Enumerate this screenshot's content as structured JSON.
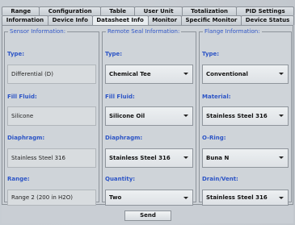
{
  "tabs": {
    "row1": [
      "Range",
      "Configuration",
      "Table",
      "User Unit",
      "Totalization",
      "PID Settings"
    ],
    "row2": [
      "Information",
      "Device Info",
      "Datasheet Info",
      "Monitor",
      "Specific Monitor",
      "Device Status"
    ],
    "active": "Datasheet Info"
  },
  "sensor": {
    "legend": "Sensor Information:",
    "type_label": "Type:",
    "type_value": "Differential (D)",
    "fill_label": "Fill Fluid:",
    "fill_value": "Silicone",
    "diaphragm_label": "Diaphragm:",
    "diaphragm_value": "Stainless Steel 316",
    "range_label": "Range:",
    "range_value": "Range 2 (200 in H2O)"
  },
  "remote": {
    "legend": "Remote Seal Information:",
    "type_label": "Type:",
    "type_value": "Chemical Tee",
    "fill_label": "Fill Fluid:",
    "fill_value": "Silicone Oil",
    "diaphragm_label": "Diaphragm:",
    "diaphragm_value": "Stainless Steel 316",
    "quantity_label": "Quantity:",
    "quantity_value": "Two"
  },
  "flange": {
    "legend": "Flange Information:",
    "type_label": "Type:",
    "type_value": "Conventional",
    "material_label": "Material:",
    "material_value": "Stainless Steel 316",
    "oring_label": "O-Ring:",
    "oring_value": "Buna N",
    "drain_label": "Drain/Vent:",
    "drain_value": "Stainless Steel 316"
  },
  "footer": {
    "send_label": "Send"
  }
}
